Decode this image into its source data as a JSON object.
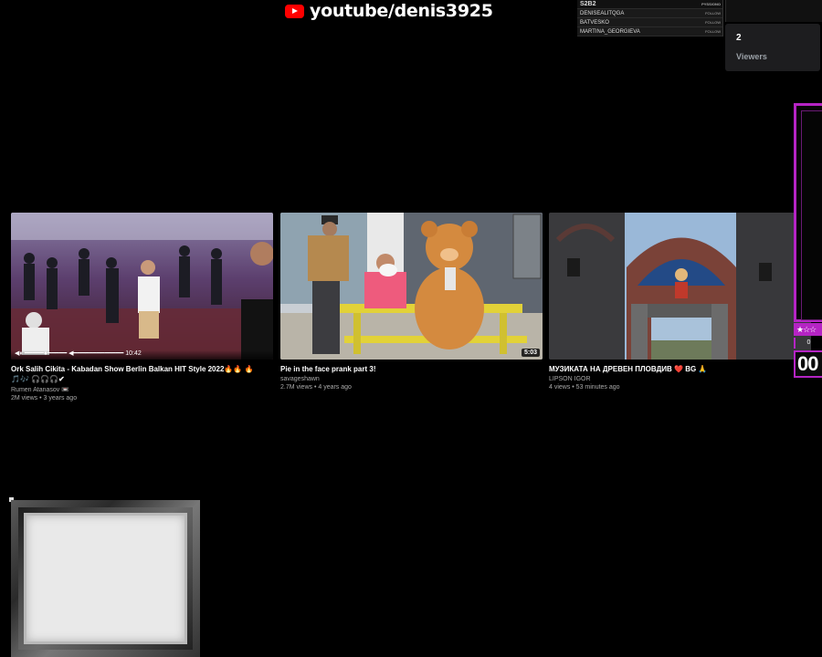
{
  "overlay": {
    "channel_handle": "youtube/denis3925",
    "chat": {
      "header": "S2B2",
      "header_tag": "PYSS/ONO",
      "rows": [
        {
          "name": "DENISEALITQGA",
          "tag": "FOLLOW"
        },
        {
          "name": "BATVESKO",
          "tag": "FOLLOW"
        },
        {
          "name": "MARTINA_GEORGIEVA",
          "tag": "FOLLOW"
        }
      ]
    },
    "viewers": {
      "count": "2",
      "label": "Viewers"
    },
    "side_panel": {
      "stars": "★☆☆",
      "count": "0",
      "timer": "00"
    }
  },
  "videos": [
    {
      "title": "Ork Salih Cikita - Kabadan Show Berlin Balkan HIT Style 2022🔥🔥 🔥🎵🎶 🎧🎧🎧✔",
      "channel": "Rumen Atanasov 📼",
      "meta": "2M views • 3 years ago",
      "duration": "10:42",
      "player_controls": "◀⏸ ━━━━━●━━━━━ ◀━━━━━━━━━━━━━ 10:42"
    },
    {
      "title": "Pie in the face prank part 3!",
      "channel": "savageshawn",
      "meta": "2.7M views • 4 years ago",
      "duration": "5:03"
    },
    {
      "title": "МУЗИКАТА НА ДРЕВЕН ПЛОВДИВ ❤️ BG 🙏",
      "channel": "LIPSON IGOR",
      "meta": "4 views • 53 minutes ago",
      "duration": ""
    }
  ],
  "colors": {
    "accent": "#b524c4",
    "youtube_red": "#ff0000",
    "background": "#000000"
  },
  "icons": [
    "youtube-logo-icon",
    "star-icon"
  ]
}
